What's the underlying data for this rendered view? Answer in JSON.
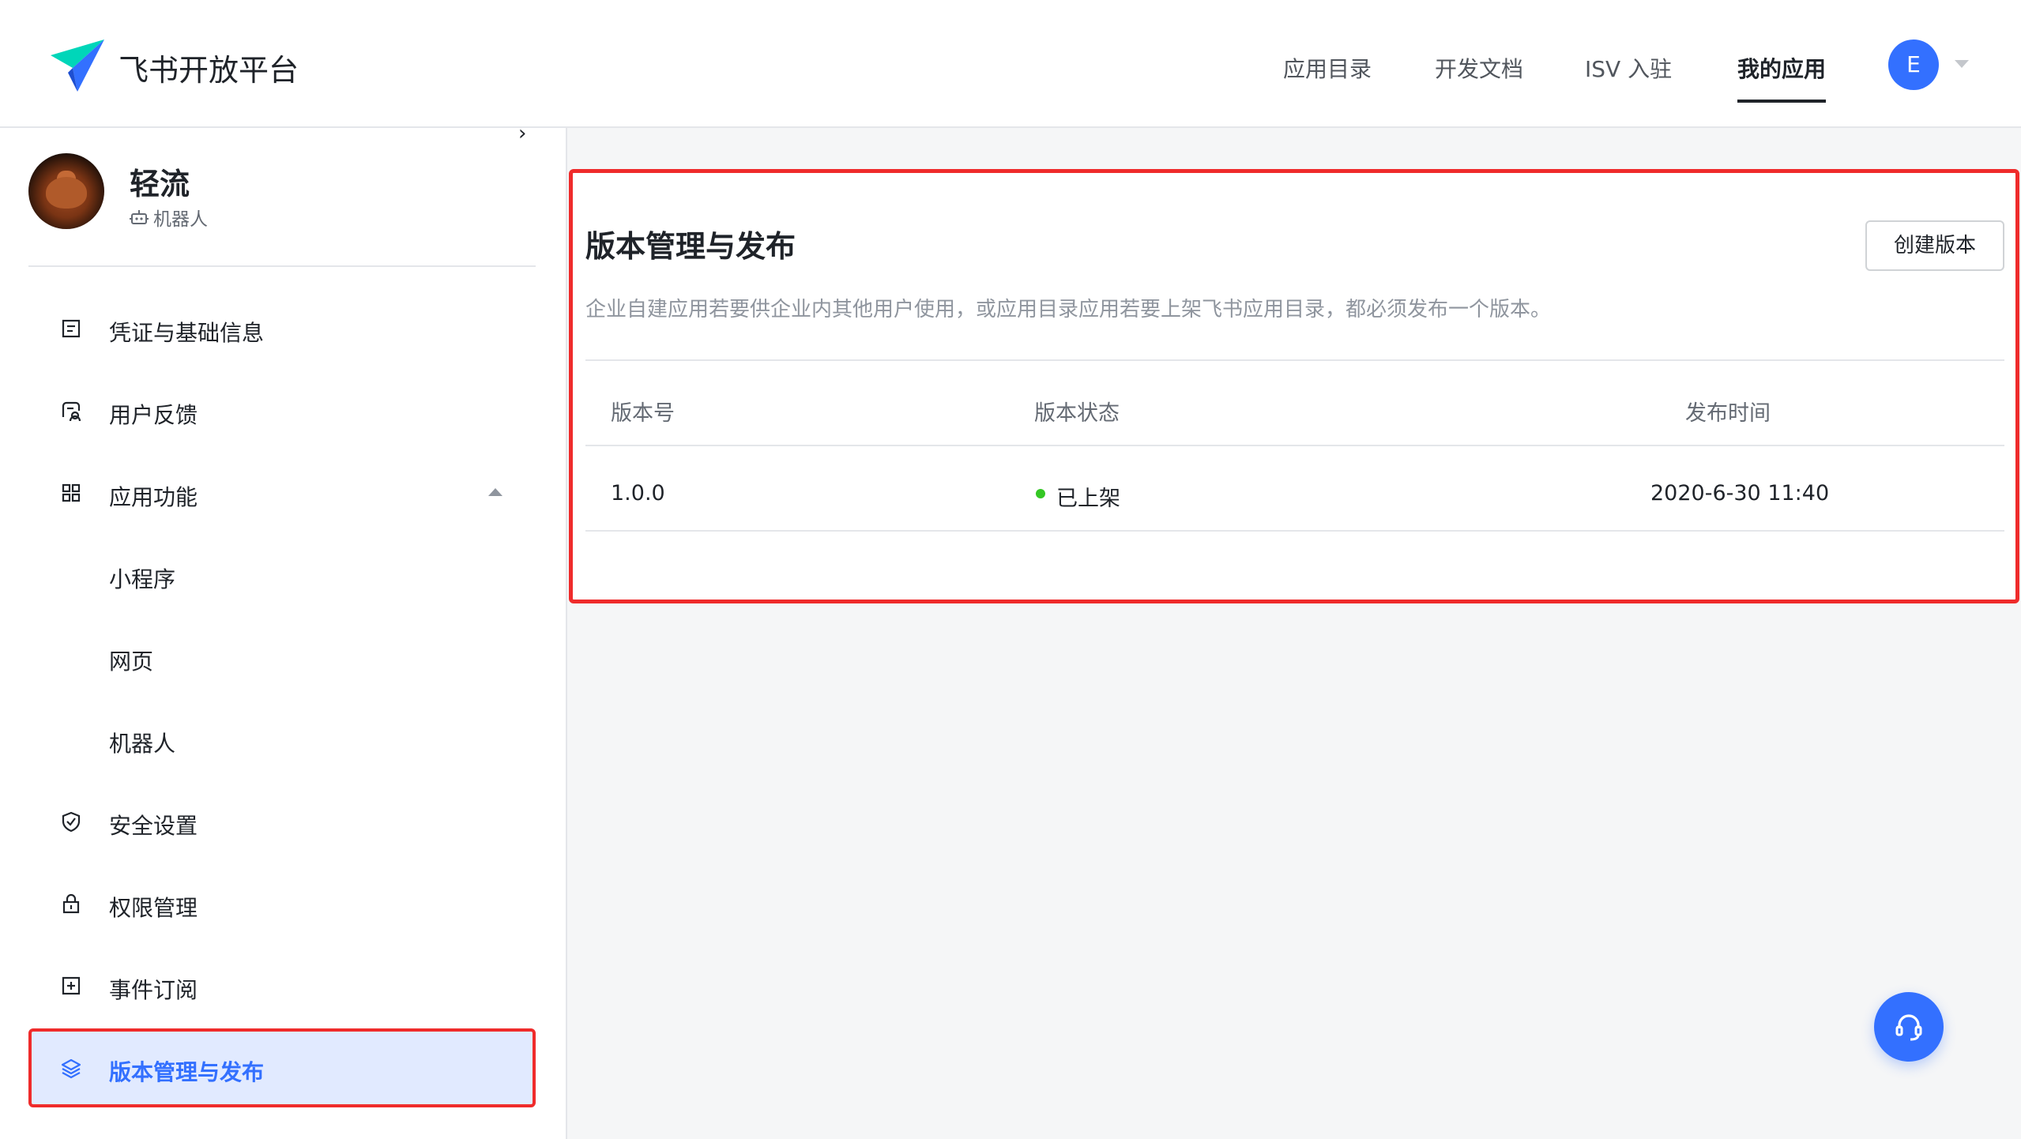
{
  "header": {
    "brand": "飞书开放平台",
    "nav": [
      "应用目录",
      "开发文档",
      "ISV 入驻",
      "我的应用"
    ],
    "active_nav": "我的应用",
    "user_initial": "E"
  },
  "sidebar": {
    "collapse_glyph": "›",
    "app_name": "轻流",
    "app_type": "机器人",
    "items": [
      {
        "label": "凭证与基础信息",
        "icon": "credential-icon"
      },
      {
        "label": "用户反馈",
        "icon": "feedback-icon"
      },
      {
        "label": "应用功能",
        "icon": "apps-grid-icon",
        "expanded": true
      },
      {
        "label": "小程序",
        "sub": true
      },
      {
        "label": "网页",
        "sub": true
      },
      {
        "label": "机器人",
        "sub": true
      },
      {
        "label": "安全设置",
        "icon": "shield-icon"
      },
      {
        "label": "权限管理",
        "icon": "lock-icon"
      },
      {
        "label": "事件订阅",
        "icon": "event-subscribe-icon"
      },
      {
        "label": "版本管理与发布",
        "icon": "layers-icon",
        "active": true
      }
    ]
  },
  "main": {
    "title": "版本管理与发布",
    "create_button": "创建版本",
    "description": "企业自建应用若要供企业内其他用户使用，或应用目录应用若要上架飞书应用目录，都必须发布一个版本。",
    "table": {
      "columns": [
        "版本号",
        "版本状态",
        "发布时间"
      ],
      "rows": [
        {
          "version": "1.0.0",
          "status": "已上架",
          "published_at": "2020-6-30 11:40"
        }
      ]
    }
  },
  "colors": {
    "brand_blue": "#3370ff",
    "highlight_red": "#ef2b2b",
    "status_green": "#34c724",
    "active_bg": "#e1eaff"
  }
}
